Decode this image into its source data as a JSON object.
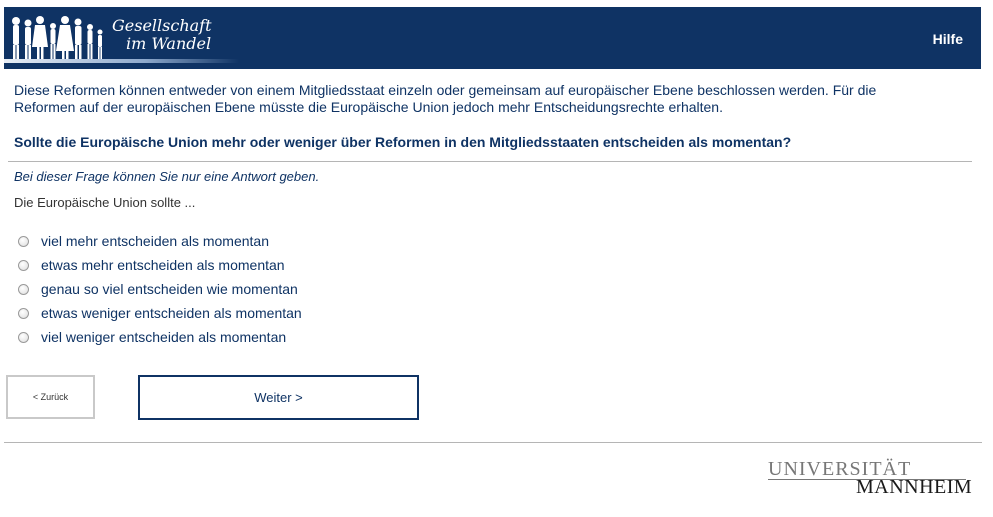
{
  "header": {
    "brand_line1": "Gesellschaft",
    "brand_line2": "im Wandel",
    "help_label": "Hilfe",
    "colors": {
      "background": "#0f3364",
      "text": "#ffffff"
    }
  },
  "intro_text": "Diese Reformen können entweder von einem Mitgliedsstaat einzeln oder gemeinsam auf europäischer Ebene beschlossen werden. Für die Reformen auf der europäischen Ebene müsste die Europäische Union jedoch mehr Entscheidungsrechte erhalten.",
  "question": "Sollte die Europäische Union mehr oder weniger über Reformen in den Mitgliedsstaaten entscheiden als momentan?",
  "hint": "Bei dieser Frage können Sie nur eine Antwort geben.",
  "stem": "Die Europäische Union sollte ...",
  "options": [
    "viel mehr entscheiden als momentan",
    "etwas mehr entscheiden als momentan",
    "genau so viel entscheiden wie momentan",
    "etwas weniger entscheiden als momentan",
    "viel weniger entscheiden als momentan"
  ],
  "nav": {
    "back_label": "< Zurück",
    "next_label": "Weiter >"
  },
  "footer": {
    "logo_line1": "UNIVERSITÄT",
    "logo_line2": "MANNHEIM"
  }
}
